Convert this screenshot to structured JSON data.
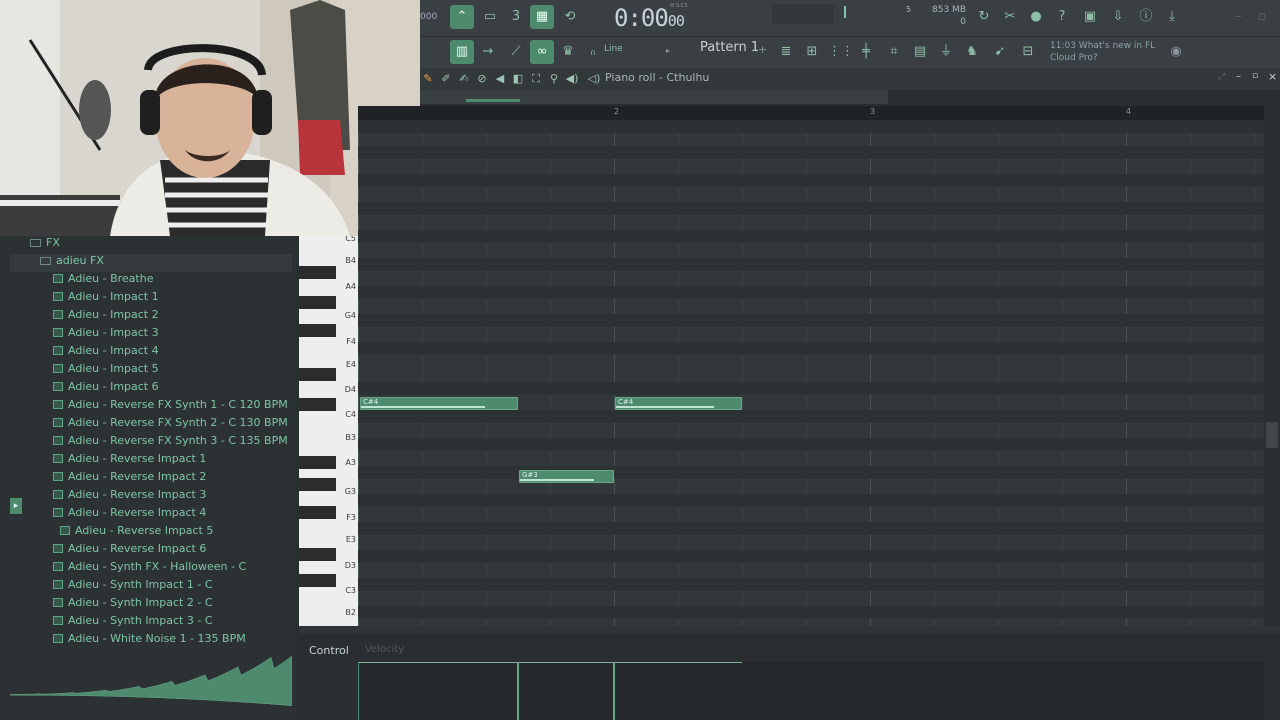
{
  "toolbar": {
    "tempo": "000",
    "clock_main": "0:00",
    "clock_sub": "00",
    "clock_unit": "M:S:CS",
    "cpu_label": "5",
    "memory": "853 MB",
    "poly": "0",
    "snap": "Line",
    "pattern": "Pattern 1",
    "news_line1": "11:03  What's new in FL",
    "news_line2": "Cloud Pro?"
  },
  "piano_roll": {
    "title": "Piano roll - Cthulhu",
    "bar_numbers": [
      "2",
      "3",
      "4"
    ],
    "key_labels": [
      "C5",
      "B4",
      "A4",
      "G4",
      "F4",
      "E4",
      "D4",
      "C4",
      "B3",
      "A3",
      "G3",
      "F3",
      "E3",
      "D3",
      "C3",
      "B2"
    ],
    "notes": [
      {
        "label": "C#4"
      },
      {
        "label": "C#4"
      },
      {
        "label": "G#3"
      }
    ]
  },
  "browser": {
    "root_folder": "FX",
    "subfolder": "adieu FX",
    "items": [
      "Adieu - Breathe",
      "Adieu - Impact 1",
      "Adieu - Impact 2",
      "Adieu - Impact 3",
      "Adieu - Impact 4",
      "Adieu - Impact 5",
      "Adieu - Impact 6",
      "Adieu - Reverse FX Synth 1 - C 120 BPM",
      "Adieu - Reverse FX Synth 2 - C 130 BPM",
      "Adieu - Reverse FX Synth 3 - C 135 BPM",
      "Adieu - Reverse Impact 1",
      "Adieu - Reverse Impact 2",
      "Adieu - Reverse Impact 3",
      "Adieu - Reverse Impact 4",
      "Adieu - Reverse Impact 5",
      "Adieu - Reverse Impact 6",
      "Adieu - Synth FX - Halloween - C",
      "Adieu - Synth Impact 1 - C",
      "Adieu - Synth Impact 2 - C",
      "Adieu - Synth Impact 3 - C",
      "Adieu - White Noise 1 - 135 BPM"
    ],
    "selected_index": 14
  },
  "control": {
    "label": "Control",
    "sub": "Velocity"
  },
  "colors": {
    "accent": "#4e8a6e",
    "note": "#4e8a6e",
    "background": "#2a2e31"
  }
}
